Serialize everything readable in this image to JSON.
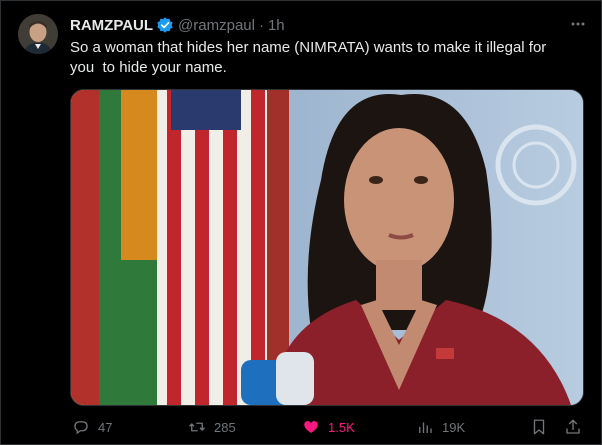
{
  "tweet": {
    "author": {
      "display_name": "RAMZPAUL",
      "handle": "@ramzpaul",
      "verified": true
    },
    "separator": "·",
    "time": "1h",
    "text": "So a woman that hides her name (NIMRATA) wants to make it illegal for\nyou  to hide your name.",
    "more_icon": "more-horizontal-icon"
  },
  "actions": {
    "replies": "47",
    "reposts": "285",
    "likes": "1.5K",
    "views": "19K"
  },
  "colors": {
    "background": "#000000",
    "text": "#e7e9ea",
    "muted": "#71767b",
    "verified": "#1d9bf0",
    "like": "#f91880"
  },
  "icons": [
    "reply-icon",
    "repost-icon",
    "like-icon",
    "views-icon",
    "bookmark-icon",
    "share-icon"
  ]
}
